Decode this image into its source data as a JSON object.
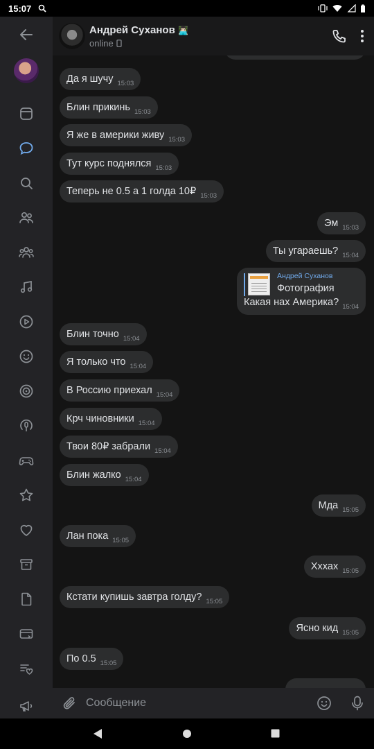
{
  "status_bar": {
    "time": "15:07"
  },
  "contact": {
    "name": "Андрей Суханов",
    "status": "online"
  },
  "messages": [
    {
      "text": "Да я шучу",
      "time": "15:03"
    },
    {
      "text": "Блин прикинь",
      "time": "15:03"
    },
    {
      "text": "Я же в америки живу",
      "time": "15:03"
    },
    {
      "text": "Тут курс поднялся",
      "time": "15:03"
    },
    {
      "text": "Теперь не 0.5 а 1 голда 10₽",
      "time": "15:03"
    },
    {
      "text": "Эм",
      "time": "15:03"
    },
    {
      "text": "Ты угараешь?",
      "time": "15:04"
    },
    {
      "text": "Блин точно",
      "time": "15:04"
    },
    {
      "text": "Я только что",
      "time": "15:04"
    },
    {
      "text": "В Россию приехал",
      "time": "15:04"
    },
    {
      "text": "Крч чиновники",
      "time": "15:04"
    },
    {
      "text": "Твои 80₽ забрали",
      "time": "15:04"
    },
    {
      "text": "Блин жалко",
      "time": "15:04"
    },
    {
      "text": "Мда",
      "time": "15:05"
    },
    {
      "text": "Лан пока",
      "time": "15:05"
    },
    {
      "text": "Хххах",
      "time": "15:05"
    },
    {
      "text": "Кстати купишь завтра голду?",
      "time": "15:05"
    },
    {
      "text": "Ясно кид",
      "time": "15:05"
    },
    {
      "text": "По 0.5",
      "time": "15:05"
    }
  ],
  "forwarded": {
    "author": "Андрей Суханов",
    "type": "Фотография",
    "text": "Какая нах Америка?",
    "time": "15:04"
  },
  "composer": {
    "placeholder": "Сообщение"
  },
  "icons": {
    "sidebar": [
      "back-arrow-icon",
      "avatar",
      "news-icon",
      "messages-icon",
      "search-icon",
      "friends-icon",
      "communities-icon",
      "music-icon",
      "video-icon",
      "emoji-icon",
      "games-icon",
      "podcast-icon",
      "gamepad-icon",
      "star-icon",
      "heart-icon",
      "archive-icon",
      "documents-icon",
      "payments-icon",
      "likes-list-icon",
      "megaphone-icon"
    ],
    "accent": "#71aaeb"
  }
}
